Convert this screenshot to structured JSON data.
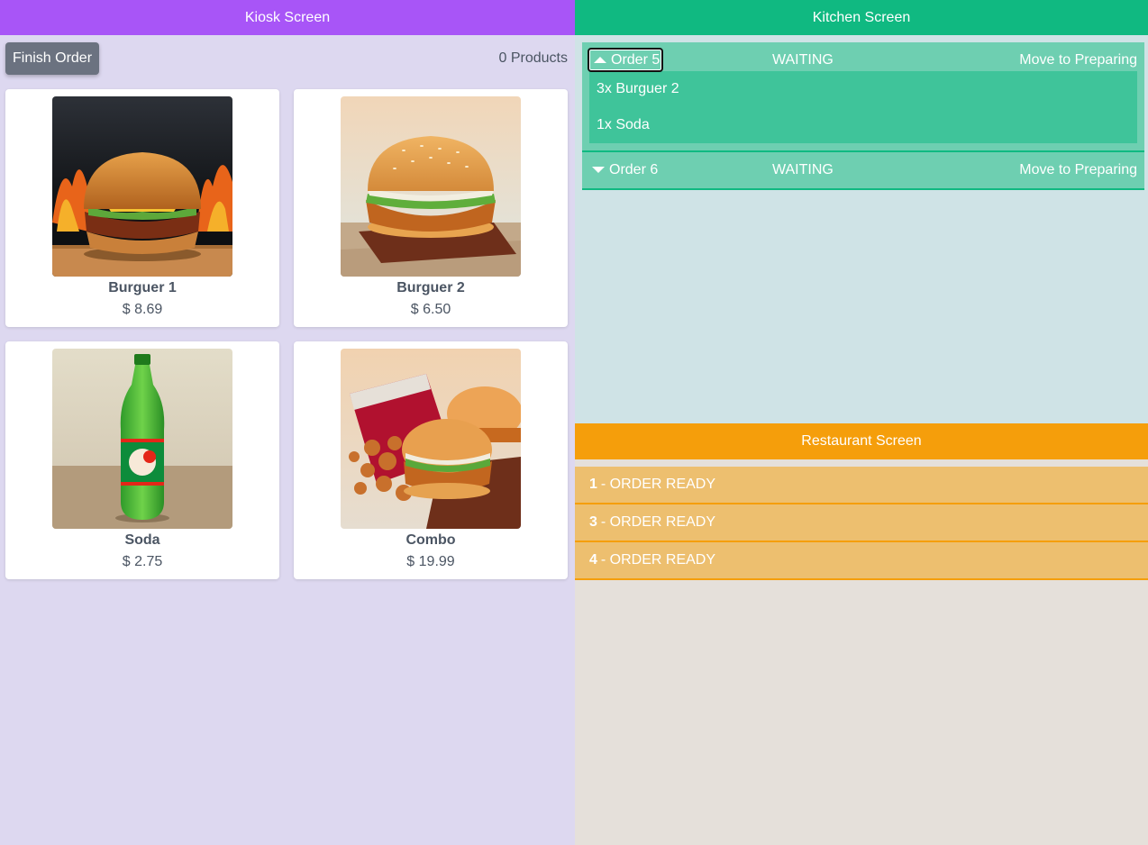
{
  "kiosk": {
    "title": "Kiosk Screen",
    "finish_label": "Finish Order",
    "product_count": "0 Products",
    "products": [
      {
        "name": "Burguer 1",
        "price": "$ 8.69"
      },
      {
        "name": "Burguer 2",
        "price": "$ 6.50"
      },
      {
        "name": "Soda",
        "price": "$ 2.75"
      },
      {
        "name": "Combo",
        "price": "$ 19.99"
      }
    ]
  },
  "kitchen": {
    "title": "Kitchen Screen",
    "orders": [
      {
        "label": "Order 5",
        "status": "WAITING",
        "action": "Move to Preparing",
        "expanded": true,
        "items": [
          "3x Burguer 2",
          "1x Soda"
        ]
      },
      {
        "label": "Order 6",
        "status": "WAITING",
        "action": "Move to Preparing",
        "expanded": false,
        "items": []
      }
    ]
  },
  "restaurant": {
    "title": "Restaurant Screen",
    "ready": [
      {
        "number": "1",
        "text": "- ORDER READY"
      },
      {
        "number": "3",
        "text": "- ORDER READY"
      },
      {
        "number": "4",
        "text": "- ORDER READY"
      }
    ]
  },
  "colors": {
    "kiosk_accent": "#a855f7",
    "kitchen_accent": "#10b981",
    "restaurant_accent": "#f59e0b"
  },
  "icons": {
    "expanded": "chevron-up-icon",
    "collapsed": "chevron-down-icon"
  }
}
